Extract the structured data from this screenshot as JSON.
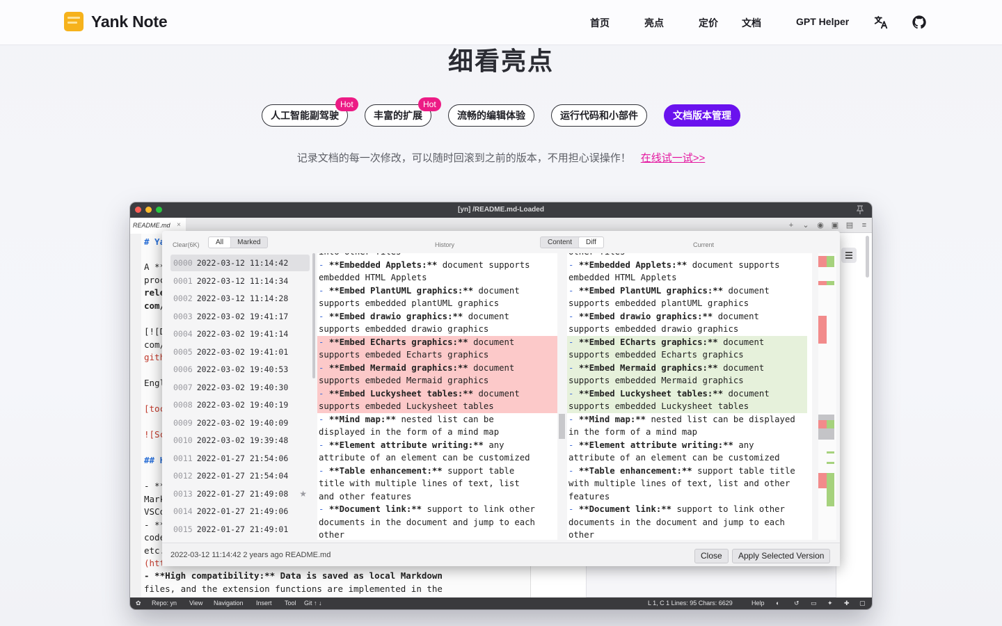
{
  "brand": {
    "name": "Yank Note"
  },
  "nav": {
    "items": [
      "首页",
      "亮点",
      "定价",
      "文档",
      "GPT Helper"
    ],
    "icons": [
      "translate-icon",
      "github-icon"
    ]
  },
  "highlights": {
    "title": "细看亮点",
    "tabs": [
      "人工智能副驾驶",
      "丰富的扩展",
      "流畅的编辑体验",
      "运行代码和小部件",
      "文档版本管理"
    ],
    "hot_label": "Hot",
    "description": "记录文档的每一次修改，可以随时回滚到之前的版本，不用担心误操作！",
    "try_link": "在线试一试>>"
  },
  "window": {
    "title": "[yn] /README.md-Loaded",
    "tab": "README.md",
    "tab_close": "×",
    "status": {
      "repo": "Repo: yn",
      "view": "View",
      "navigation": "Navigation",
      "insert": "Insert",
      "tool": "Tool",
      "git": "Git ↑ ↓",
      "position": "L 1, C 1  Lines: 95  Chars: 6629",
      "help": "Help"
    },
    "editor_bg": [
      "# Ya",
      "A **",
      "proc",
      "rele",
      "com/",
      "[![D",
      "com/",
      "gith",
      "Engl",
      "[toc",
      "![Sc",
      "## H",
      "- **",
      "Mark",
      "VSCo",
      "- **",
      "code",
      "etc.",
      "(htt",
      "- **High compatibility:** Data is saved as local Markdown",
      "files, and the extension functions are implemented in the"
    ]
  },
  "history": {
    "clear": "Clear(6K)",
    "filter": {
      "all": "All",
      "marked": "Marked"
    },
    "history_label": "History",
    "current_label": "Current",
    "mode": {
      "content": "Content",
      "diff": "Diff"
    },
    "versions": [
      {
        "idx": "0000",
        "time": "2022-03-12 11:14:42"
      },
      {
        "idx": "0001",
        "time": "2022-03-12 11:14:34"
      },
      {
        "idx": "0002",
        "time": "2022-03-12 11:14:28"
      },
      {
        "idx": "0003",
        "time": "2022-03-02 19:41:17"
      },
      {
        "idx": "0004",
        "time": "2022-03-02 19:41:14"
      },
      {
        "idx": "0005",
        "time": "2022-03-02 19:41:01"
      },
      {
        "idx": "0006",
        "time": "2022-03-02 19:40:53"
      },
      {
        "idx": "0007",
        "time": "2022-03-02 19:40:30"
      },
      {
        "idx": "0008",
        "time": "2022-03-02 19:40:19"
      },
      {
        "idx": "0009",
        "time": "2022-03-02 19:40:09"
      },
      {
        "idx": "0010",
        "time": "2022-03-02 19:39:48"
      },
      {
        "idx": "0011",
        "time": "2022-01-27 21:54:06"
      },
      {
        "idx": "0012",
        "time": "2022-01-27 21:54:04"
      },
      {
        "idx": "0013",
        "time": "2022-01-27 21:49:08",
        "starred": true
      },
      {
        "idx": "0014",
        "time": "2022-01-27 21:49:06"
      },
      {
        "idx": "0015",
        "time": "2022-01-27 21:49:01"
      }
    ],
    "left_lines": [
      {
        "t": "plain",
        "text": "into other files"
      },
      {
        "t": "plain",
        "dash": "- ",
        "bold": "**Embedded Applets:**",
        "rest": " document supports"
      },
      {
        "t": "plain",
        "text": "embedded HTML Applets"
      },
      {
        "t": "plain",
        "dash": "- ",
        "bold": "**Embed PlantUML graphics:**",
        "rest": " document"
      },
      {
        "t": "plain",
        "text": "supports embedded plantUML graphics"
      },
      {
        "t": "plain",
        "dash": "- ",
        "bold": "**Embed drawio graphics:**",
        "rest": " document"
      },
      {
        "t": "plain",
        "text": "supports embedded drawio graphics"
      },
      {
        "t": "del",
        "dash": "- ",
        "bold": "**Embed ECharts graphics:**",
        "rest": " document"
      },
      {
        "t": "del",
        "text": "supports embeded Echarts graphics"
      },
      {
        "t": "del",
        "dash": "- ",
        "bold": "**Embed Mermaid graphics:**",
        "rest": " document"
      },
      {
        "t": "del",
        "text": "supports embeded Mermaid graphics"
      },
      {
        "t": "del",
        "dash": "- ",
        "bold": "**Embed Luckysheet tables:**",
        "rest": " document"
      },
      {
        "t": "del",
        "text": "supports embeded Luckysheet tables"
      },
      {
        "t": "plain",
        "dash": "- ",
        "bold": "**Mind map:**",
        "rest": " nested list can be"
      },
      {
        "t": "plain",
        "text": "displayed in the form of a mind map"
      },
      {
        "t": "plain",
        "dash": "- ",
        "bold": "**Element attribute writing:**",
        "rest": " any"
      },
      {
        "t": "plain",
        "text": "attribute of an element can be customized"
      },
      {
        "t": "plain",
        "dash": "- ",
        "bold": "**Table enhancement:**",
        "rest": " support table"
      },
      {
        "t": "plain",
        "text": "title with multiple lines of text, list"
      },
      {
        "t": "plain",
        "text": "and other features"
      },
      {
        "t": "plain",
        "dash": "- ",
        "bold": "**Document link:**",
        "rest": " support to link other"
      },
      {
        "t": "plain",
        "text": "documents in the document and jump to each"
      },
      {
        "t": "plain",
        "text": "other"
      }
    ],
    "right_lines": [
      {
        "t": "plain",
        "text": "other files"
      },
      {
        "t": "plain",
        "dash": "- ",
        "bold": "**Embedded Applets:**",
        "rest": " document supports"
      },
      {
        "t": "plain",
        "text": "embedded HTML Applets"
      },
      {
        "t": "plain",
        "dash": "- ",
        "bold": "**Embed PlantUML graphics:**",
        "rest": " document"
      },
      {
        "t": "plain",
        "text": "supports embedded plantUML graphics"
      },
      {
        "t": "plain",
        "dash": "- ",
        "bold": "**Embed drawio graphics:**",
        "rest": " document"
      },
      {
        "t": "plain",
        "text": "supports embedded drawio graphics"
      },
      {
        "t": "add",
        "dash": "- ",
        "bold": "**Embed ECharts graphics:**",
        "rest": " document"
      },
      {
        "t": "add",
        "text": "supports embedded Echarts graphics"
      },
      {
        "t": "add",
        "dash": "- ",
        "bold": "**Embed Mermaid graphics:**",
        "rest": " document"
      },
      {
        "t": "add",
        "text": "supports embedded Mermaid graphics"
      },
      {
        "t": "add",
        "dash": "- ",
        "bold": "**Embed Luckysheet tables:**",
        "rest": " document"
      },
      {
        "t": "add",
        "text": "supports embedded Luckysheet tables"
      },
      {
        "t": "plain",
        "dash": "- ",
        "bold": "**Mind map:**",
        "rest": " nested list can be displayed"
      },
      {
        "t": "plain",
        "text": "in the form of a mind map"
      },
      {
        "t": "plain",
        "dash": "- ",
        "bold": "**Element attribute writing:**",
        "rest": " any"
      },
      {
        "t": "plain",
        "text": "attribute of an element can be customized"
      },
      {
        "t": "plain",
        "dash": "- ",
        "bold": "**Table enhancement:**",
        "rest": " support table title"
      },
      {
        "t": "plain",
        "text": "with multiple lines of text, list and other"
      },
      {
        "t": "plain",
        "text": "features"
      },
      {
        "t": "plain",
        "dash": "- ",
        "bold": "**Document link:**",
        "rest": " support to link other"
      },
      {
        "t": "plain",
        "text": "documents in the document and jump to each"
      },
      {
        "t": "plain",
        "text": "other"
      }
    ],
    "footer_info": "2022-03-12 11:14:42 2 years ago README.md",
    "close_button": "Close",
    "apply_button": "Apply Selected Version"
  },
  "colors": {
    "accent": "#6a12ee",
    "hot": "#ec1b85",
    "link": "#e418a0",
    "diff_deleted": "#fcc9c9",
    "diff_added": "#e6f1db"
  }
}
